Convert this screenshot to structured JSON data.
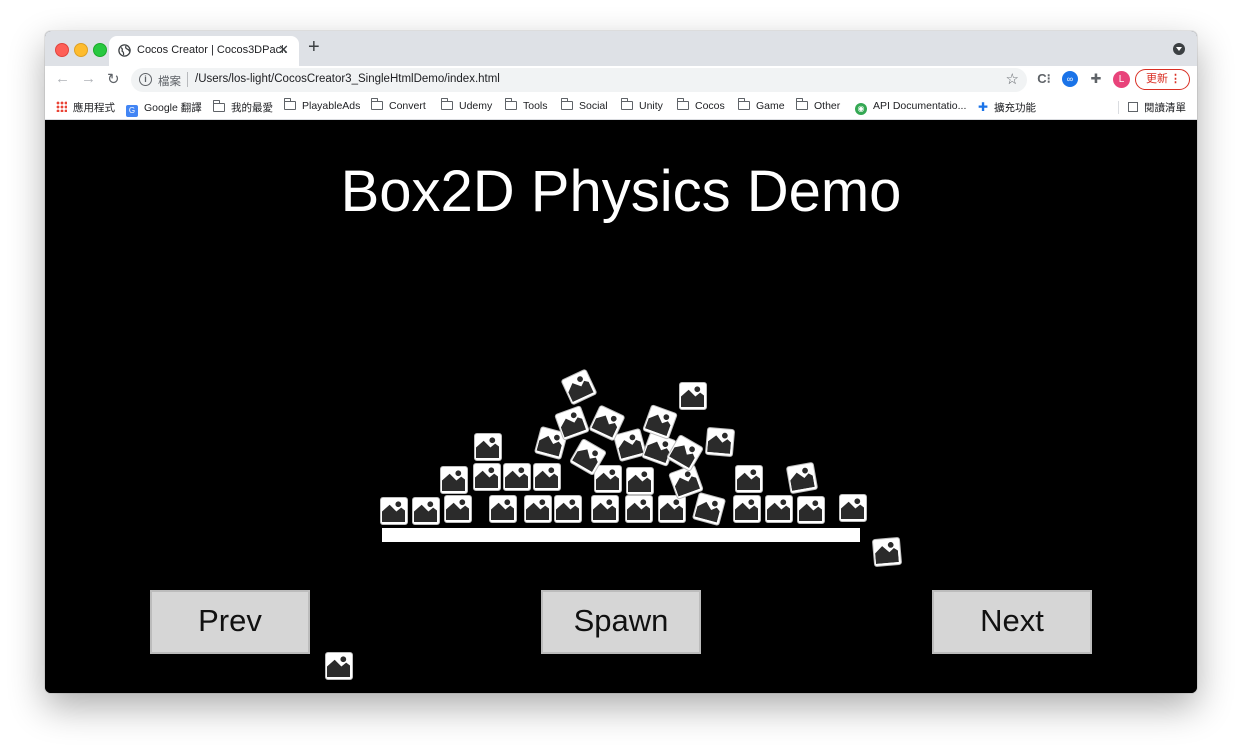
{
  "browser": {
    "tab_title": "Cocos Creator | Cocos3DPack",
    "tab_close": "✕",
    "new_tab": "+",
    "scheme_label": "檔案",
    "url": "/Users/los-light/CocosCreator3_SingleHtmlDemo/index.html",
    "avatar_letter": "L",
    "update_label": "更新",
    "update_menu": "⋮",
    "bookmarks": [
      {
        "label": "應用程式",
        "icon": "apps-grid-icon"
      },
      {
        "label": "Google 翻譯",
        "icon": "google-translate-icon"
      },
      {
        "label": "我的最愛",
        "icon": "folder-icon"
      },
      {
        "label": "PlayableAds",
        "icon": "folder-icon"
      },
      {
        "label": "Convert",
        "icon": "folder-icon"
      },
      {
        "label": "Udemy",
        "icon": "folder-icon"
      },
      {
        "label": "Tools",
        "icon": "folder-icon"
      },
      {
        "label": "Social",
        "icon": "folder-icon"
      },
      {
        "label": "Unity",
        "icon": "folder-icon"
      },
      {
        "label": "Cocos",
        "icon": "folder-icon"
      },
      {
        "label": "Game",
        "icon": "folder-icon"
      },
      {
        "label": "Other",
        "icon": "folder-icon"
      },
      {
        "label": "API Documentatio...",
        "icon": "api-doc-icon"
      },
      {
        "label": "擴充功能",
        "icon": "extension-puzzle-icon"
      }
    ],
    "reading_list": "閱讀清單",
    "colors": {
      "tabstrip": "#dee1e6",
      "update_red": "#d93025",
      "avatar": "#e8437a"
    }
  },
  "game": {
    "title": "Box2D Physics Demo",
    "buttons": {
      "prev": "Prev",
      "spawn": "Spawn",
      "next": "Next"
    },
    "background": "#000000",
    "box_icon": "image-placeholder-icon"
  }
}
